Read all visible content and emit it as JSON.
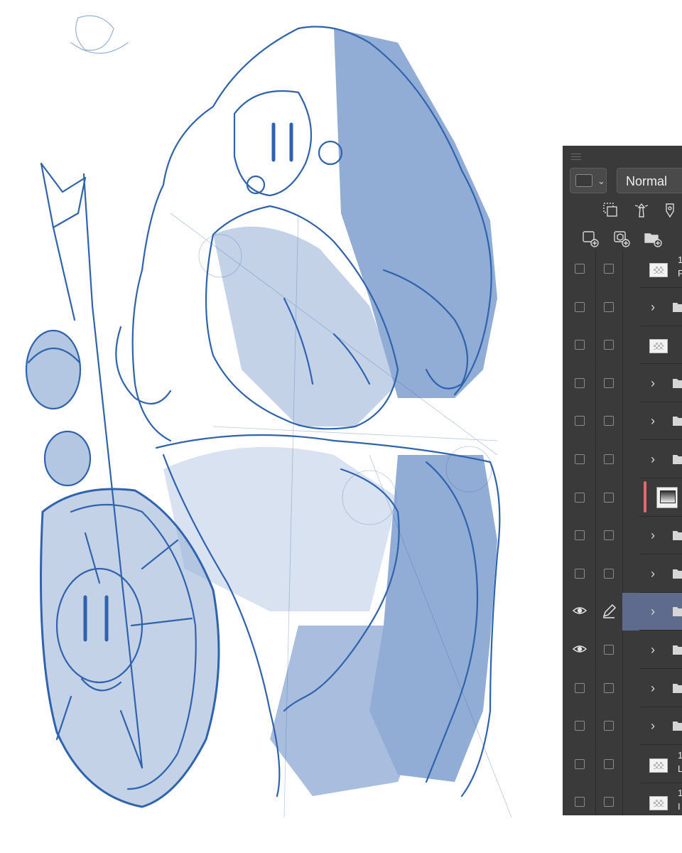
{
  "canvas": {
    "ink_color": "#2f63ad",
    "shade_color": "#7f9fce"
  },
  "layer_panel": {
    "blend_mode": "Normal",
    "background": "#3a3a3a",
    "selected_color": "#5f6b8c",
    "accent_color": "#e06a70",
    "toolbar_top": [
      "merge-icon",
      "lighthouse-icon",
      "pin-icon"
    ],
    "toolbar_bottom": [
      "new-raster-layer-icon",
      "new-3d-layer-icon",
      "new-folder-icon"
    ],
    "layers": [
      {
        "kind": "raster",
        "name_line1": "1",
        "name_line2": "F",
        "visible": false,
        "editing": false,
        "selected": false
      },
      {
        "kind": "folder",
        "visible": false,
        "editing": false,
        "selected": false
      },
      {
        "kind": "raster",
        "visible": false,
        "editing": false,
        "selected": false
      },
      {
        "kind": "folder",
        "visible": false,
        "editing": false,
        "selected": false
      },
      {
        "kind": "folder",
        "visible": false,
        "editing": false,
        "selected": false
      },
      {
        "kind": "folder",
        "visible": false,
        "editing": false,
        "selected": false
      },
      {
        "kind": "gradient",
        "visible": false,
        "editing": false,
        "selected": false
      },
      {
        "kind": "folder",
        "visible": false,
        "editing": false,
        "selected": false
      },
      {
        "kind": "folder",
        "visible": false,
        "editing": false,
        "selected": false
      },
      {
        "kind": "folder",
        "visible": true,
        "editing": true,
        "selected": true
      },
      {
        "kind": "folder",
        "visible": true,
        "editing": false,
        "selected": false
      },
      {
        "kind": "folder",
        "visible": false,
        "editing": false,
        "selected": false
      },
      {
        "kind": "folder",
        "visible": false,
        "editing": false,
        "selected": false
      },
      {
        "kind": "raster",
        "name_line1": "1",
        "name_line2": "L",
        "visible": false,
        "editing": false,
        "selected": false
      },
      {
        "kind": "raster",
        "name_line1": "1",
        "name_line2": "I",
        "visible": false,
        "editing": false,
        "selected": false
      }
    ]
  }
}
